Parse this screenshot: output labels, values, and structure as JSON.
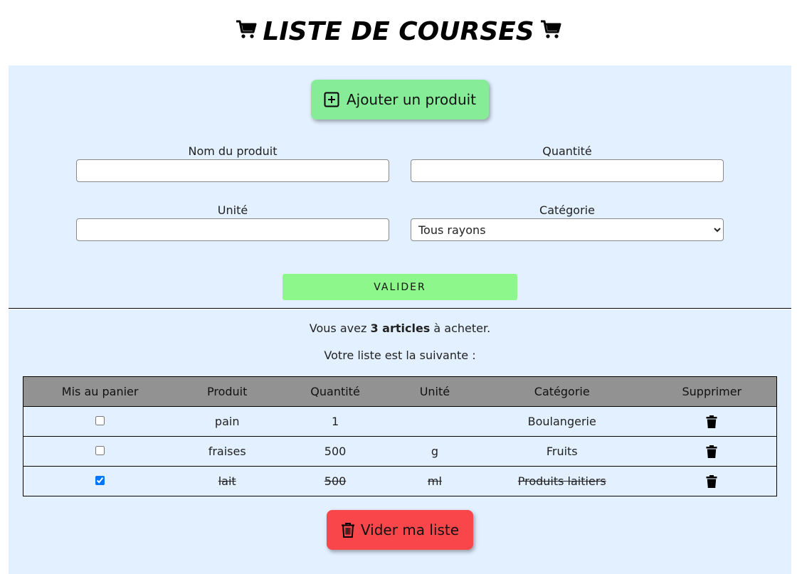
{
  "header": {
    "title": "LISTE DE COURSES",
    "left_icon": "cart-icon",
    "right_icon": "cart-icon"
  },
  "form": {
    "add_button_label": "Ajouter un produit",
    "add_button_icon": "plus-square-icon",
    "nom_label": "Nom du produit",
    "nom_value": "",
    "quantite_label": "Quantité",
    "quantite_value": "",
    "unite_label": "Unité",
    "unite_value": "",
    "categorie_label": "Catégorie",
    "categorie_selected": "Tous rayons",
    "submit_label": "VALIDER"
  },
  "summary": {
    "prefix": "Vous avez ",
    "count_text": "3 articles",
    "suffix": " à acheter.",
    "subtitle": "Votre liste est la suivante :"
  },
  "table": {
    "headers": [
      "Mis au panier",
      "Produit",
      "Quantité",
      "Unité",
      "Catégorie",
      "Supprimer"
    ],
    "rows": [
      {
        "checked": false,
        "produit": "pain",
        "quantite": "1",
        "unite": "",
        "categorie": "Boulangerie"
      },
      {
        "checked": false,
        "produit": "fraises",
        "quantite": "500",
        "unite": "g",
        "categorie": "Fruits"
      },
      {
        "checked": true,
        "produit": "lait",
        "quantite": "500",
        "unite": "ml",
        "categorie": "Produits laitiers"
      }
    ],
    "delete_icon": "trash-icon"
  },
  "footer": {
    "clear_button_label": "Vider ma liste",
    "clear_button_icon": "trash-outline-icon"
  },
  "colors": {
    "panel_bg": "#e3f0ff",
    "add_button": "#86ec97",
    "submit_button": "#8ef78c",
    "header_row": "#929292",
    "clear_button": "#f9464b"
  }
}
